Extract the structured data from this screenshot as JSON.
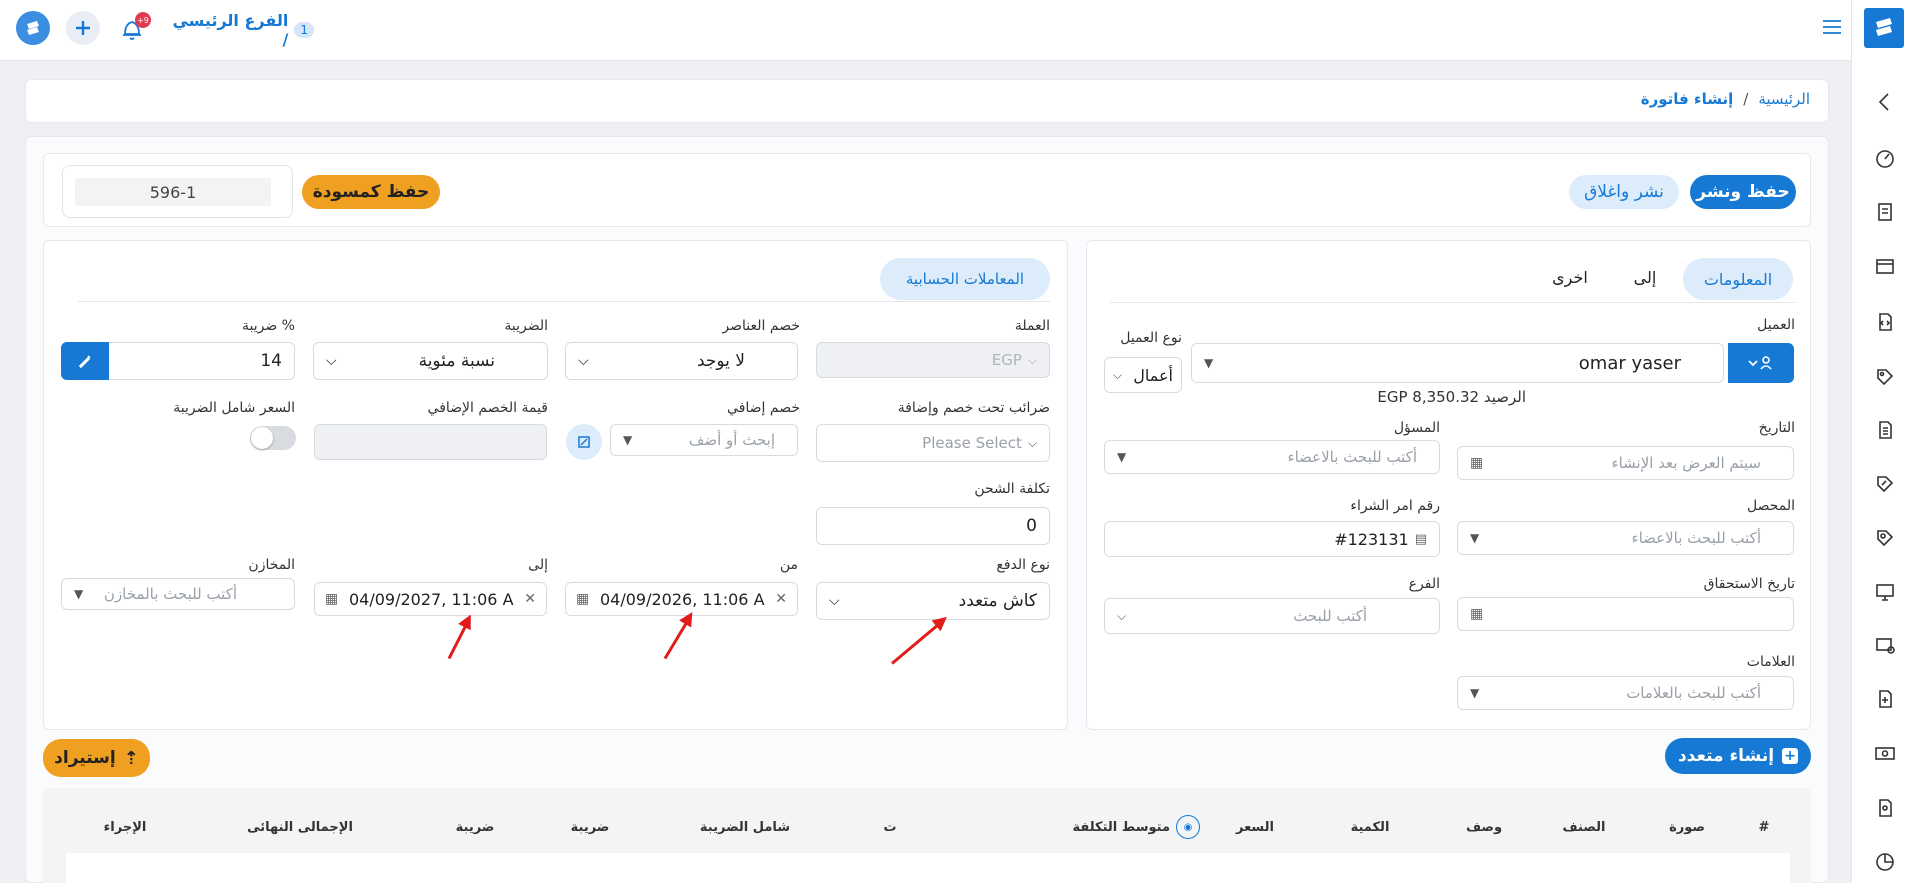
{
  "header": {
    "branch_count": "1",
    "branch_name": "الفرع الرئيسي /",
    "notif_badge": "+9"
  },
  "breadcrumb": {
    "home": "الرئيسية",
    "sep": "/",
    "current": "إنشاء فاتورة"
  },
  "actions": {
    "save_publish": "حفظ ونشر",
    "publish_close": "نشر واغلاق",
    "save_draft": "حفظ كمسودة",
    "invoice_number": "596-1"
  },
  "tabs": {
    "info": "المعلومات",
    "to": "إلى",
    "other": "اخرى",
    "accounting": "المعاملات الحسابية"
  },
  "customer": {
    "label": "العميل",
    "value": "omar yaser",
    "type_label": "نوع العميل",
    "type_value": "أعمال",
    "balance": "الرصيد EGP 8,350.32"
  },
  "left_form": {
    "date_label": "التاريخ",
    "date_placeholder": "سيتم العرض بعد الإنشاء",
    "responsible_label": "المسؤل",
    "responsible_placeholder": "أكتب للبحث بالاعضاء",
    "collector_label": "المحصل",
    "collector_placeholder": "أكتب للبحث بالاعضاء",
    "po_label": "رقم امر الشراء",
    "po_value": "#123131",
    "due_label": "تاريخ الاستحقاق",
    "branch_label": "الفرع",
    "branch_placeholder": "أكتب للبحث",
    "tags_label": "العلامات",
    "tags_placeholder": "أكتب للبحث بالعلامات"
  },
  "right_form": {
    "currency_label": "العملة",
    "currency_value": "EGP",
    "item_discount_label": "خصم العناصر",
    "item_discount_value": "لا يوجد",
    "tax_label": "الضريبة",
    "tax_value": "نسبة مئوية",
    "tax_pct_label": "ضريبة %",
    "tax_pct_value": "14",
    "taxes_under_label": "ضرائب تحت خصم وإضافة",
    "taxes_under_placeholder": "Please Select",
    "extra_discount_label": "خصم إضافي",
    "extra_discount_placeholder": "إبحث أو أضف",
    "extra_discount_value_label": "قيمة الخصم الإضافي",
    "tax_inclusive_label": "السعر شامل الضريبة",
    "shipping_label": "تكلفة الشحن",
    "shipping_value": "0",
    "payment_type_label": "نوع الدفع",
    "payment_type_value": "كاش متعدد",
    "from_label": "من",
    "from_value": "04/09/2026, 11:06 A",
    "to_label": "إلى",
    "to_value": "04/09/2027, 11:06 A",
    "warehouses_label": "المخازن",
    "warehouses_placeholder": "أكتب للبحث بالمخازن"
  },
  "bulk": {
    "create_multi": "إنشاء متعدد",
    "import": "إستيراد"
  },
  "table": {
    "headers": [
      "#",
      "صورة",
      "الصنف",
      "وصف",
      "الكمية",
      "السعر",
      "متوسط التكلفة",
      "ت",
      "شامل الضريبة",
      "ضريبة",
      "ضريبة",
      "الإجمالى النهائى",
      "الإجراء"
    ]
  },
  "colors": {
    "primary": "#1679d4",
    "accent": "#f0a020",
    "soft_blue": "#dcecfa",
    "arrow": "#e21b1b"
  }
}
